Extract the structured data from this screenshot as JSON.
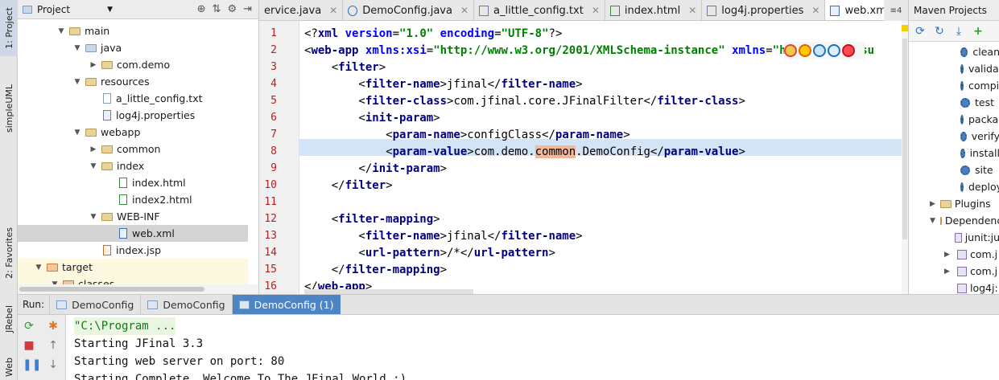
{
  "left_strip": {
    "tabs": [
      "1: Project",
      "simpleUML",
      "2: Favorites",
      "JRebel",
      "Web"
    ]
  },
  "project": {
    "title": "Project",
    "tree": [
      {
        "label": "main",
        "kind": "folder",
        "expanded": true
      },
      {
        "label": "java",
        "kind": "folder-blue",
        "expanded": true
      },
      {
        "label": "com.demo",
        "kind": "folder",
        "expanded": false
      },
      {
        "label": "resources",
        "kind": "folder",
        "expanded": true
      },
      {
        "label": "a_little_config.txt",
        "kind": "file"
      },
      {
        "label": "log4j.properties",
        "kind": "file-prop"
      },
      {
        "label": "webapp",
        "kind": "folder",
        "expanded": true
      },
      {
        "label": "common",
        "kind": "folder",
        "expanded": false
      },
      {
        "label": "index",
        "kind": "folder",
        "expanded": true
      },
      {
        "label": "index.html",
        "kind": "file-html"
      },
      {
        "label": "index2.html",
        "kind": "file-html"
      },
      {
        "label": "WEB-INF",
        "kind": "folder",
        "expanded": true
      },
      {
        "label": "web.xml",
        "kind": "file-xml",
        "selected": true
      },
      {
        "label": "index.jsp",
        "kind": "file-jsp"
      },
      {
        "label": "target",
        "kind": "folder-orange",
        "expanded": true
      },
      {
        "label": "classes",
        "kind": "folder-orange",
        "expanded": true
      }
    ]
  },
  "editor_tabs": [
    {
      "label": "ervice.java",
      "icon": "class-icon"
    },
    {
      "label": "DemoConfig.java",
      "icon": "class-icon"
    },
    {
      "label": "a_little_config.txt",
      "icon": "text-file-icon"
    },
    {
      "label": "index.html",
      "icon": "html-file-icon"
    },
    {
      "label": "log4j.properties",
      "icon": "properties-file-icon"
    },
    {
      "label": "web.xml",
      "icon": "xml-file-icon",
      "active": true
    }
  ],
  "tab_overflow": "≡4",
  "editor": {
    "line_numbers": [
      "1",
      "2",
      "3",
      "4",
      "5",
      "6",
      "7",
      "8",
      "9",
      "10",
      "11",
      "12",
      "13",
      "14",
      "15",
      "16"
    ],
    "highlighted_line": 8
  },
  "maven": {
    "title": "Maven Projects",
    "lifecycle": [
      "clean",
      "validate",
      "compile",
      "test",
      "package",
      "verify",
      "install",
      "site",
      "deploy"
    ],
    "plugins_label": "Plugins",
    "dependencies_label": "Dependencies",
    "deps": [
      "junit:ju",
      "com.j",
      "com.j",
      "log4j:"
    ]
  },
  "run": {
    "label": "Run:",
    "tabs": [
      "DemoConfig",
      "DemoConfig",
      "DemoConfig (1)"
    ],
    "console": [
      "\"C:\\Program ...",
      "Starting JFinal 3.3",
      "Starting web server on port: 80",
      "Starting Complete. Welcome To The JFinal World :)"
    ]
  }
}
